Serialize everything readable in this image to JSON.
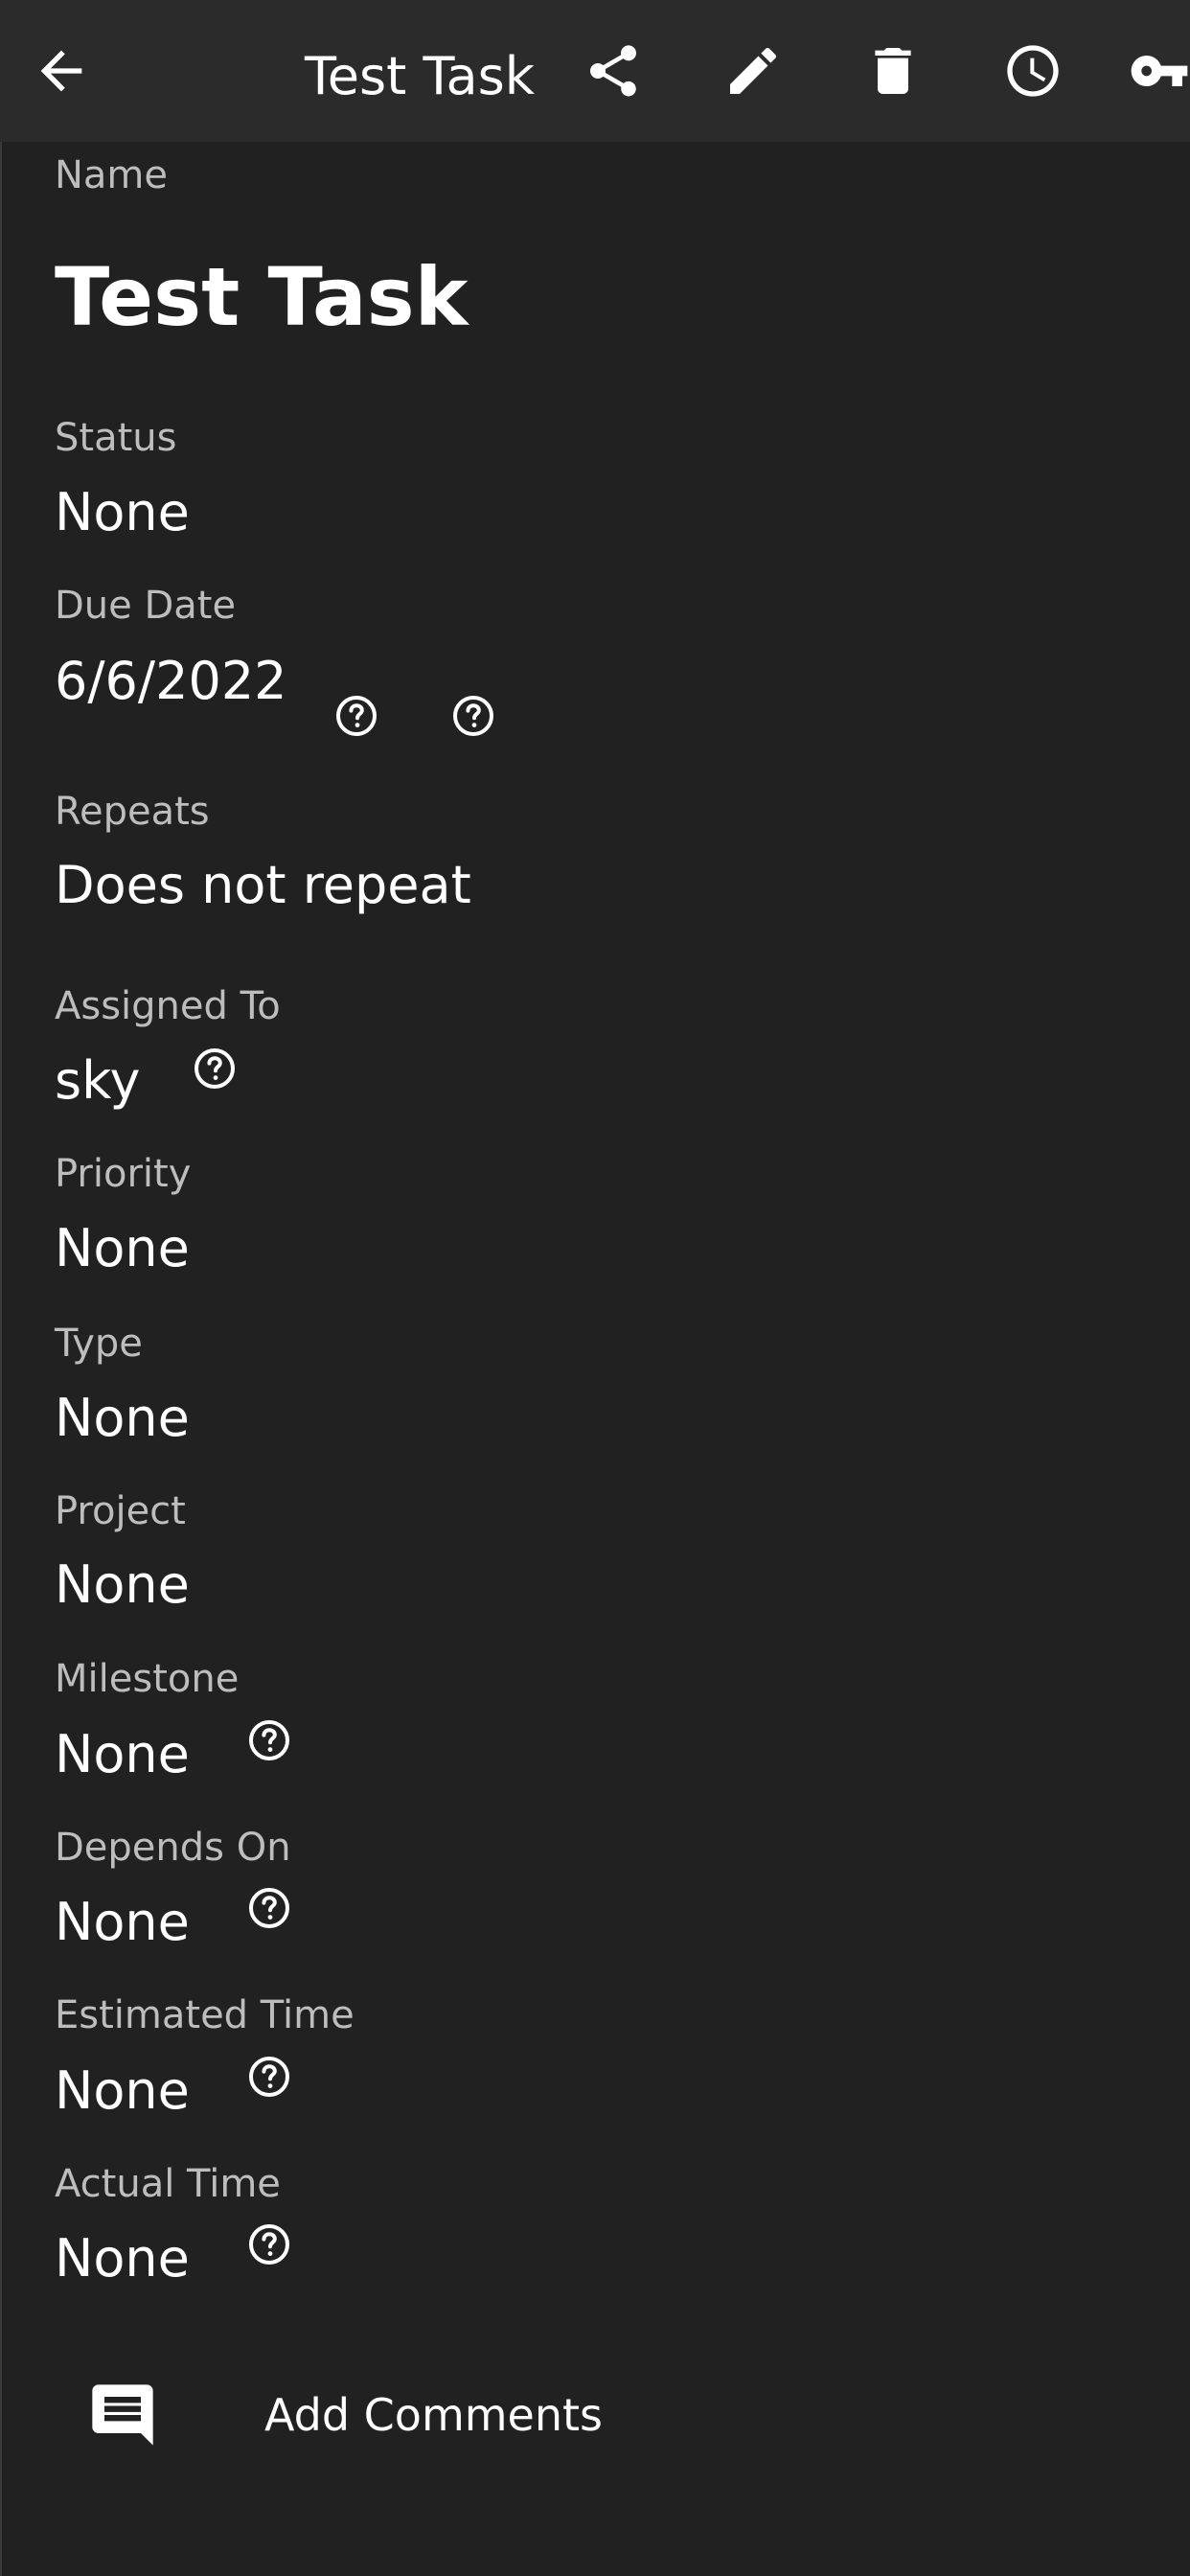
{
  "toolbar": {
    "title": "Test Task",
    "back_icon": "arrow-left-icon",
    "share_icon": "share-icon",
    "edit_icon": "pencil-icon",
    "delete_icon": "trash-icon",
    "history_icon": "clock-icon",
    "key_icon": "key-icon"
  },
  "fields": {
    "name": {
      "label": "Name",
      "value": "Test Task"
    },
    "status": {
      "label": "Status",
      "value": "None"
    },
    "due_date": {
      "label": "Due Date",
      "value": "6/6/2022"
    },
    "repeats": {
      "label": "Repeats",
      "value": "Does not repeat"
    },
    "assigned_to": {
      "label": "Assigned To",
      "value": "sky"
    },
    "priority": {
      "label": "Priority",
      "value": "None"
    },
    "type": {
      "label": "Type",
      "value": "None"
    },
    "project": {
      "label": "Project",
      "value": "None"
    },
    "milestone": {
      "label": "Milestone",
      "value": "None"
    },
    "depends_on": {
      "label": "Depends On",
      "value": "None"
    },
    "estimated_time": {
      "label": "Estimated Time",
      "value": "None"
    },
    "actual_time": {
      "label": "Actual Time",
      "value": "None"
    }
  },
  "comments": {
    "label": "Add Comments",
    "icon": "comment-icon"
  },
  "colors": {
    "background": "#212121",
    "toolbar": "#2b2b2b",
    "label": "#bdbdbd",
    "text": "#ffffff"
  }
}
